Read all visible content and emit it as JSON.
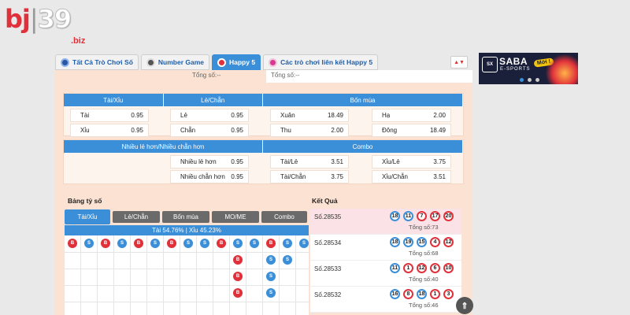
{
  "logo": {
    "bj": "bj",
    "sep": "|",
    "num": "39",
    "suffix": ".biz"
  },
  "tabs": [
    {
      "label": "Tất Cả Trò Chơi Số",
      "icon": "grid-icon"
    },
    {
      "label": "Number Game",
      "icon": "number-ball-icon"
    },
    {
      "label": "Happy 5",
      "icon": "happy5-icon",
      "active": true
    },
    {
      "label": "Các trò chơi liên kết Happy 5",
      "icon": "linked-games-icon"
    }
  ],
  "totals": {
    "left": "Tổng số:--",
    "right": "Tổng số:--"
  },
  "banner": {
    "badge": "SX",
    "brand": "SABA",
    "sub": "E-SPORTS",
    "tag": "Mới !"
  },
  "bet_table_1": {
    "headers": [
      "Tài/Xỉu",
      "Lẻ/Chẵn",
      "Bốn mùa"
    ],
    "cells": [
      {
        "label": "Tài",
        "odd": "0.95"
      },
      {
        "label": "Xỉu",
        "odd": "0.95"
      },
      {
        "label": "Lẻ",
        "odd": "0.95"
      },
      {
        "label": "Chẵn",
        "odd": "0.95"
      },
      {
        "label": "Xuân",
        "odd": "18.49"
      },
      {
        "label": "Thu",
        "odd": "2.00"
      },
      {
        "label": "Hạ",
        "odd": "2.00"
      },
      {
        "label": "Đông",
        "odd": "18.49"
      }
    ]
  },
  "bet_table_2": {
    "headers": [
      "Nhiều lẻ hơn/Nhiều chẵn hơn",
      "Combo"
    ],
    "cells": [
      {
        "label": "Nhiều lẻ hơn",
        "odd": "0.95"
      },
      {
        "label": "Nhiều chẵn hơn",
        "odd": "0.95"
      },
      {
        "label": "Tài/Lẻ",
        "odd": "3.51"
      },
      {
        "label": "Tài/Chẵn",
        "odd": "3.75"
      },
      {
        "label": "Xỉu/Lẻ",
        "odd": "3.75"
      },
      {
        "label": "Xỉu/Chẵn",
        "odd": "3.51"
      }
    ]
  },
  "stats": {
    "title": "Bảng tỷ số",
    "tabs": [
      "Tài/Xỉu",
      "Lẻ/Chẵn",
      "Bốn mùa",
      "MO/ME",
      "Combo"
    ],
    "ratio": "Tài 54.76% | Xỉu 45.23%",
    "columns": [
      [
        "B"
      ],
      [
        "S"
      ],
      [
        "B"
      ],
      [
        "S"
      ],
      [
        "B"
      ],
      [
        "S"
      ],
      [
        "B"
      ],
      [
        "S"
      ],
      [
        "S"
      ],
      [
        "B"
      ],
      [
        "S",
        "B",
        "B",
        "B"
      ],
      [
        "S"
      ],
      [
        "B",
        "S",
        "S",
        "S"
      ],
      [
        "S",
        "S"
      ],
      [
        "S"
      ],
      [
        "B",
        "B"
      ]
    ]
  },
  "results": {
    "title": "Kết Quả",
    "rows": [
      {
        "id": "Số.28535",
        "balls": [
          "18",
          "11",
          "7",
          "17",
          "20"
        ],
        "total": "Tổng số:73"
      },
      {
        "id": "Số.28534",
        "balls": [
          "18",
          "19",
          "15",
          "4",
          "12"
        ],
        "total": "Tổng số:68"
      },
      {
        "id": "Số.28533",
        "balls": [
          "11",
          "1",
          "12",
          "6",
          "10"
        ],
        "total": "Tổng số:40"
      },
      {
        "id": "Số.28532",
        "balls": [
          "16",
          "8",
          "18",
          "1",
          "3"
        ],
        "total": "Tổng số:46"
      }
    ]
  },
  "scroll_top": "⇑"
}
